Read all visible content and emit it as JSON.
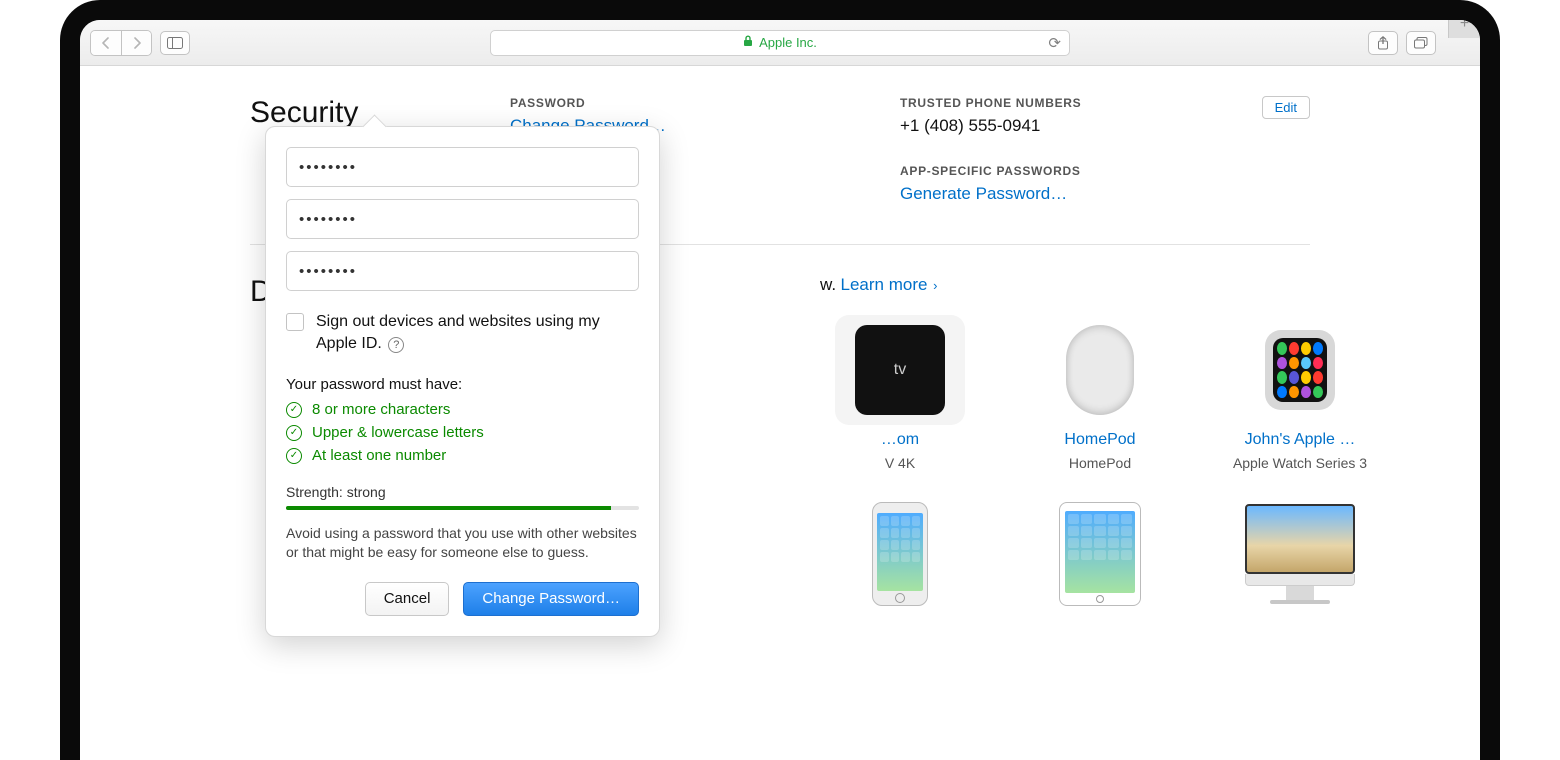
{
  "browser": {
    "site_name": "Apple Inc."
  },
  "security": {
    "title": "Security",
    "edit_label": "Edit",
    "password": {
      "label": "PASSWORD",
      "change_link": "Change Password…"
    },
    "trusted_phone": {
      "label": "TRUSTED PHONE NUMBERS",
      "value": "+1 (408) 555-0941"
    },
    "app_specific": {
      "label": "APP-SPECIFIC PASSWORDS",
      "generate_link": "Generate Password…"
    }
  },
  "devices_section": {
    "title": "Devices",
    "intro_suffix": "w.",
    "learn_more": "Learn more",
    "items": [
      {
        "name": "…om",
        "meta": "V 4K"
      },
      {
        "name": "HomePod",
        "meta": "HomePod"
      },
      {
        "name": "John's Apple …",
        "meta": "Apple Watch Series 3"
      }
    ]
  },
  "popover": {
    "field1": "••••••••",
    "field2": "••••••••",
    "field3": "••••••••",
    "signout_label": "Sign out devices and websites using my Apple ID.",
    "reqs_title": "Your password must have:",
    "req1": "8 or more characters",
    "req2": "Upper & lowercase letters",
    "req3": "At least one number",
    "strength_label": "Strength: strong",
    "tip": "Avoid using a password that you use with other websites or that might be easy for someone else to guess.",
    "cancel": "Cancel",
    "confirm": "Change Password…"
  }
}
